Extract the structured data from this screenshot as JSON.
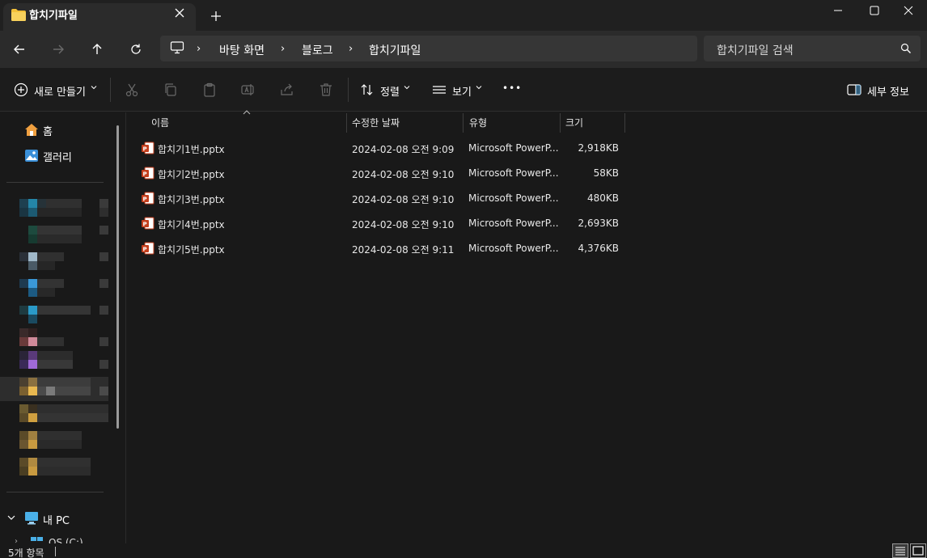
{
  "window": {
    "tab_title": "합치기파일",
    "new_tab_label": "+"
  },
  "address": {
    "crumbs": [
      "바탕 화면",
      "블로그",
      "합치기파일"
    ],
    "separator": "›"
  },
  "search": {
    "placeholder": "합치기파일 검색"
  },
  "commands": {
    "new_label": "새로 만들기",
    "sort_label": "정렬",
    "view_label": "보기",
    "more_label": "•••",
    "details_label": "세부 정보"
  },
  "sidebar": {
    "home_label": "홈",
    "gallery_label": "갤러리",
    "this_pc_label": "내 PC",
    "os_drive_label": "OS (C:)"
  },
  "columns": {
    "name": "이름",
    "modified": "수정한 날짜",
    "type": "유형",
    "size": "크기"
  },
  "files": [
    {
      "name": "합치기1번.pptx",
      "modified": "2024-02-08 오전 9:09",
      "type": "Microsoft PowerP...",
      "size": "2,918KB"
    },
    {
      "name": "합치기2번.pptx",
      "modified": "2024-02-08 오전 9:10",
      "type": "Microsoft PowerP...",
      "size": "58KB"
    },
    {
      "name": "합치기3번.pptx",
      "modified": "2024-02-08 오전 9:10",
      "type": "Microsoft PowerP...",
      "size": "480KB"
    },
    {
      "name": "합치기4번.pptx",
      "modified": "2024-02-08 오전 9:10",
      "type": "Microsoft PowerP...",
      "size": "2,693KB"
    },
    {
      "name": "합치기5번.pptx",
      "modified": "2024-02-08 오전 9:11",
      "type": "Microsoft PowerP...",
      "size": "4,376KB"
    }
  ],
  "status": {
    "item_count": "5개 항목"
  },
  "colors": {
    "accent": "#f0c040",
    "pptx": "#c43e1c"
  }
}
